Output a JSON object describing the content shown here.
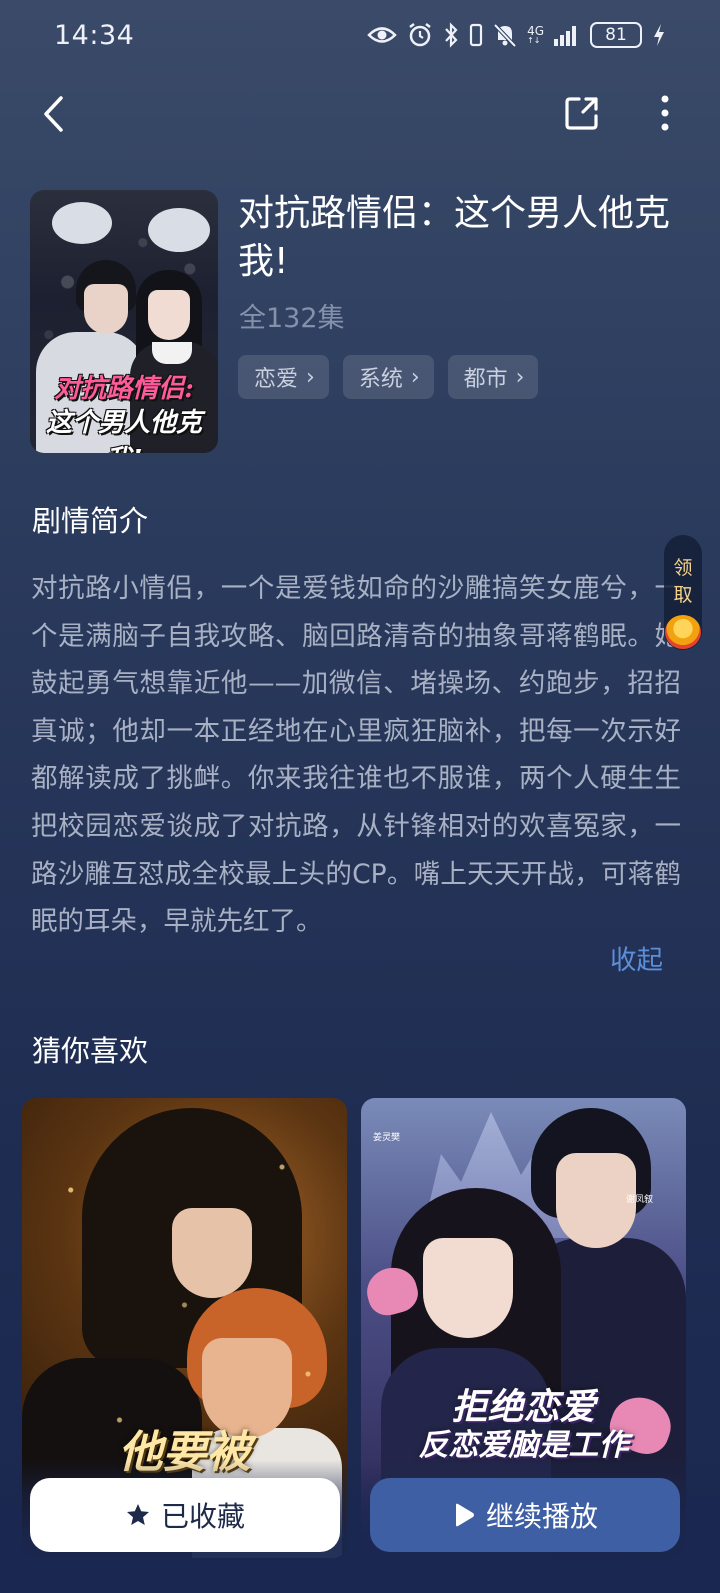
{
  "status_bar": {
    "time": "14:34",
    "battery": "81",
    "network": "4G",
    "icons": [
      "eye-icon",
      "alarm-icon",
      "bluetooth-icon",
      "mute-icon",
      "signal-icon",
      "battery-icon",
      "charging-icon"
    ]
  },
  "nav": {
    "back_icon": "back-arrow-icon",
    "share_icon": "share-icon",
    "more_icon": "more-icon"
  },
  "drama": {
    "title": "对抗路情侣：这个男人他克我!",
    "episodes": "全132集",
    "cover_title_line1": "对抗路情侣:",
    "cover_title_line2": "这个男人他克我!",
    "tags": [
      {
        "label": "恋爱"
      },
      {
        "label": "系统"
      },
      {
        "label": "都市"
      }
    ]
  },
  "synopsis": {
    "heading": "剧情简介",
    "text": "对抗路小情侣，一个是爱钱如命的沙雕搞笑女鹿兮，一个是满脑子自我攻略、脑回路清奇的抽象哥蒋鹤眠。她鼓起勇气想靠近他——加微信、堵操场、约跑步，招招真诚；他却一本正经地在心里疯狂脑补，把每一次示好都解读成了挑衅。你来我往谁也不服谁，两个人硬生生把校园恋爱谈成了对抗路，从针锋相对的欢喜冤家，一路沙雕互怼成全校最上头的CP。嘴上天天开战，可蒋鹤眠的耳朵，早就先红了。",
    "collapse_label": "收起"
  },
  "reward": {
    "label": "领取"
  },
  "recommend": {
    "heading": "猜你喜欢",
    "items": [
      {
        "cover_text": "他要被"
      },
      {
        "cover_text_1": "拒绝恋爱",
        "cover_text_2": "反恋爱脑是工作",
        "small_left": "姜灵樊",
        "small_right": "谢凤叙"
      }
    ]
  },
  "actions": {
    "collect_label": "已收藏",
    "play_label": "继续播放"
  },
  "colors": {
    "accent": "#3f5fa5",
    "link": "#5b8fd9",
    "background": "#1f2d52"
  }
}
